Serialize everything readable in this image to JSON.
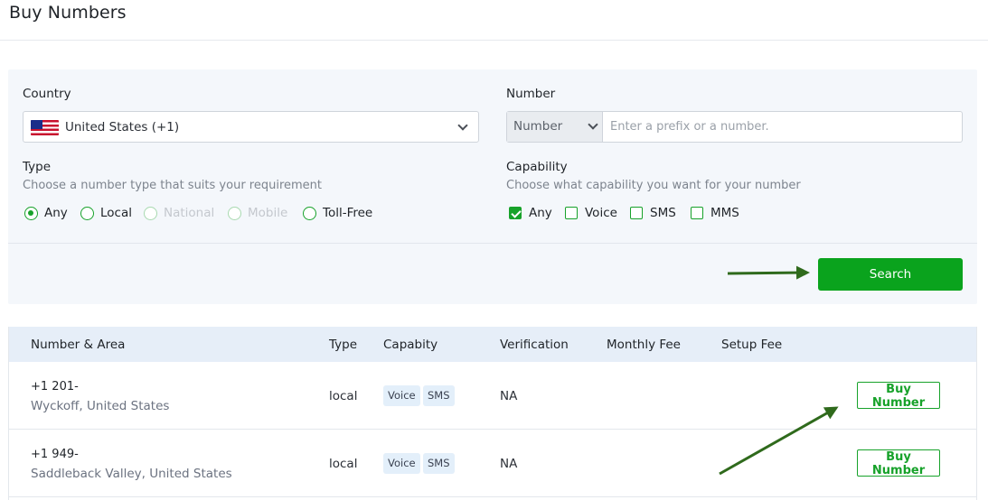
{
  "page": {
    "title": "Buy Numbers"
  },
  "filters": {
    "country": {
      "label": "Country",
      "selected": "United States (+1)",
      "flag_icon": "us-flag-icon"
    },
    "number": {
      "label": "Number",
      "mode_selected": "Number",
      "placeholder": "Enter a prefix or a number.",
      "value": ""
    },
    "type": {
      "label": "Type",
      "hint": "Choose a number type that suits your requirement",
      "options": [
        {
          "label": "Any",
          "checked": true,
          "disabled": false
        },
        {
          "label": "Local",
          "checked": false,
          "disabled": false
        },
        {
          "label": "National",
          "checked": false,
          "disabled": true
        },
        {
          "label": "Mobile",
          "checked": false,
          "disabled": true
        },
        {
          "label": "Toll-Free",
          "checked": false,
          "disabled": false
        }
      ]
    },
    "capability": {
      "label": "Capability",
      "hint": "Choose what capability you want for your number",
      "options": [
        {
          "label": "Any",
          "checked": true
        },
        {
          "label": "Voice",
          "checked": false
        },
        {
          "label": "SMS",
          "checked": false
        },
        {
          "label": "MMS",
          "checked": false
        }
      ]
    },
    "search_label": "Search"
  },
  "results": {
    "columns": [
      "Number & Area",
      "Type",
      "Capabity",
      "Verification",
      "Monthly Fee",
      "Setup Fee"
    ],
    "rows": [
      {
        "number": "+1 201-",
        "area": "Wyckoff, United States",
        "type": "local",
        "capabilities": [
          "Voice",
          "SMS"
        ],
        "verification": "NA",
        "monthly_fee": "",
        "setup_fee": "",
        "action": "Buy Number"
      },
      {
        "number": "+1 949-",
        "area": "Saddleback Valley, United States",
        "type": "local",
        "capabilities": [
          "Voice",
          "SMS"
        ],
        "verification": "NA",
        "monthly_fee": "",
        "setup_fee": "",
        "action": "Buy Number"
      }
    ]
  },
  "colors": {
    "accent_green": "#0aa31d",
    "annotation_arrow": "#2f6a1c",
    "panel_bg": "#f4f7fb",
    "table_header_bg": "#e6eef8"
  }
}
